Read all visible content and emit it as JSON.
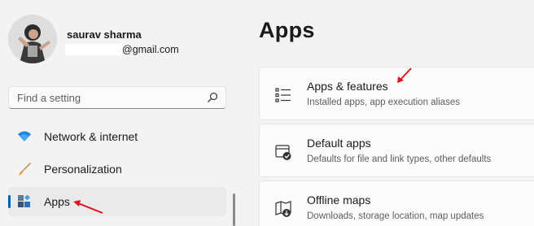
{
  "user": {
    "name": "saurav sharma",
    "email": "@gmail.com"
  },
  "search": {
    "placeholder": "Find a setting"
  },
  "sidebar": {
    "items": [
      {
        "label": "Network & internet",
        "icon": "wifi-icon"
      },
      {
        "label": "Personalization",
        "icon": "brush-icon"
      },
      {
        "label": "Apps",
        "icon": "apps-icon",
        "selected": true
      }
    ]
  },
  "main": {
    "title": "Apps",
    "cards": [
      {
        "title": "Apps & features",
        "subtitle": "Installed apps, app execution aliases",
        "icon": "list-icon"
      },
      {
        "title": "Default apps",
        "subtitle": "Defaults for file and link types, other defaults",
        "icon": "default-apps-icon"
      },
      {
        "title": "Offline maps",
        "subtitle": "Downloads, storage location, map updates",
        "icon": "map-icon"
      }
    ]
  },
  "colors": {
    "accent": "#005fb8",
    "annotation": "#e0131c",
    "background": "#f3f3f3"
  }
}
